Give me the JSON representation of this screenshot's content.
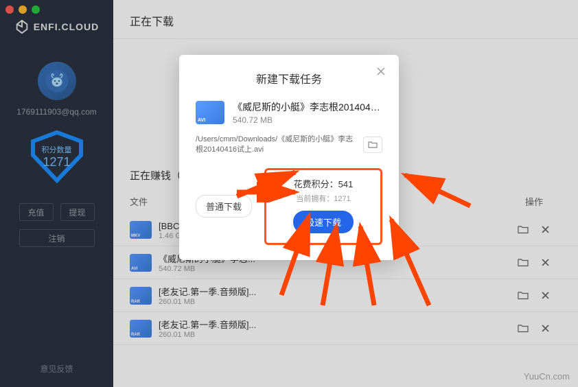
{
  "brand": "ENFI.CLOUD",
  "user": {
    "email": "1769111903@qq.com"
  },
  "points": {
    "label": "积分数量",
    "value": "1271"
  },
  "sidebar_buttons": {
    "recharge": "充值",
    "withdraw": "提现",
    "logout": "注销"
  },
  "feedback": "意见反馈",
  "main_header": "正在下载",
  "section_title": "正在赚钱（",
  "table": {
    "file_col": "文件",
    "action_col": "操作"
  },
  "files": [
    {
      "type": "MKV",
      "name": "[BBC：科学的故事.第...",
      "size": "1.46 GB"
    },
    {
      "type": "AVI",
      "name": "《威尼斯的小艇》李志...",
      "size": "540.72 MB"
    },
    {
      "type": "RAR",
      "name": "[老友记.第一季.音频版]...",
      "size": "260.01 MB"
    },
    {
      "type": "RAR",
      "name": "[老友记.第一季.音频版]...",
      "size": "260.01 MB"
    }
  ],
  "modal": {
    "title": "新建下载任务",
    "file_type": "AVI",
    "file_name": "《威尼斯的小艇》李志根2014041...",
    "file_size": "540.72 MB",
    "path": "/Users/cmm/Downloads/《威尼斯的小艇》李志根20140416试上.avi",
    "normal_download": "普通下载",
    "cost_label": "花费积分：",
    "cost_value": "541",
    "have_label": "当前拥有：",
    "have_value": "1271",
    "fast_download": "极速下载"
  },
  "watermark": "YuuCn.com"
}
